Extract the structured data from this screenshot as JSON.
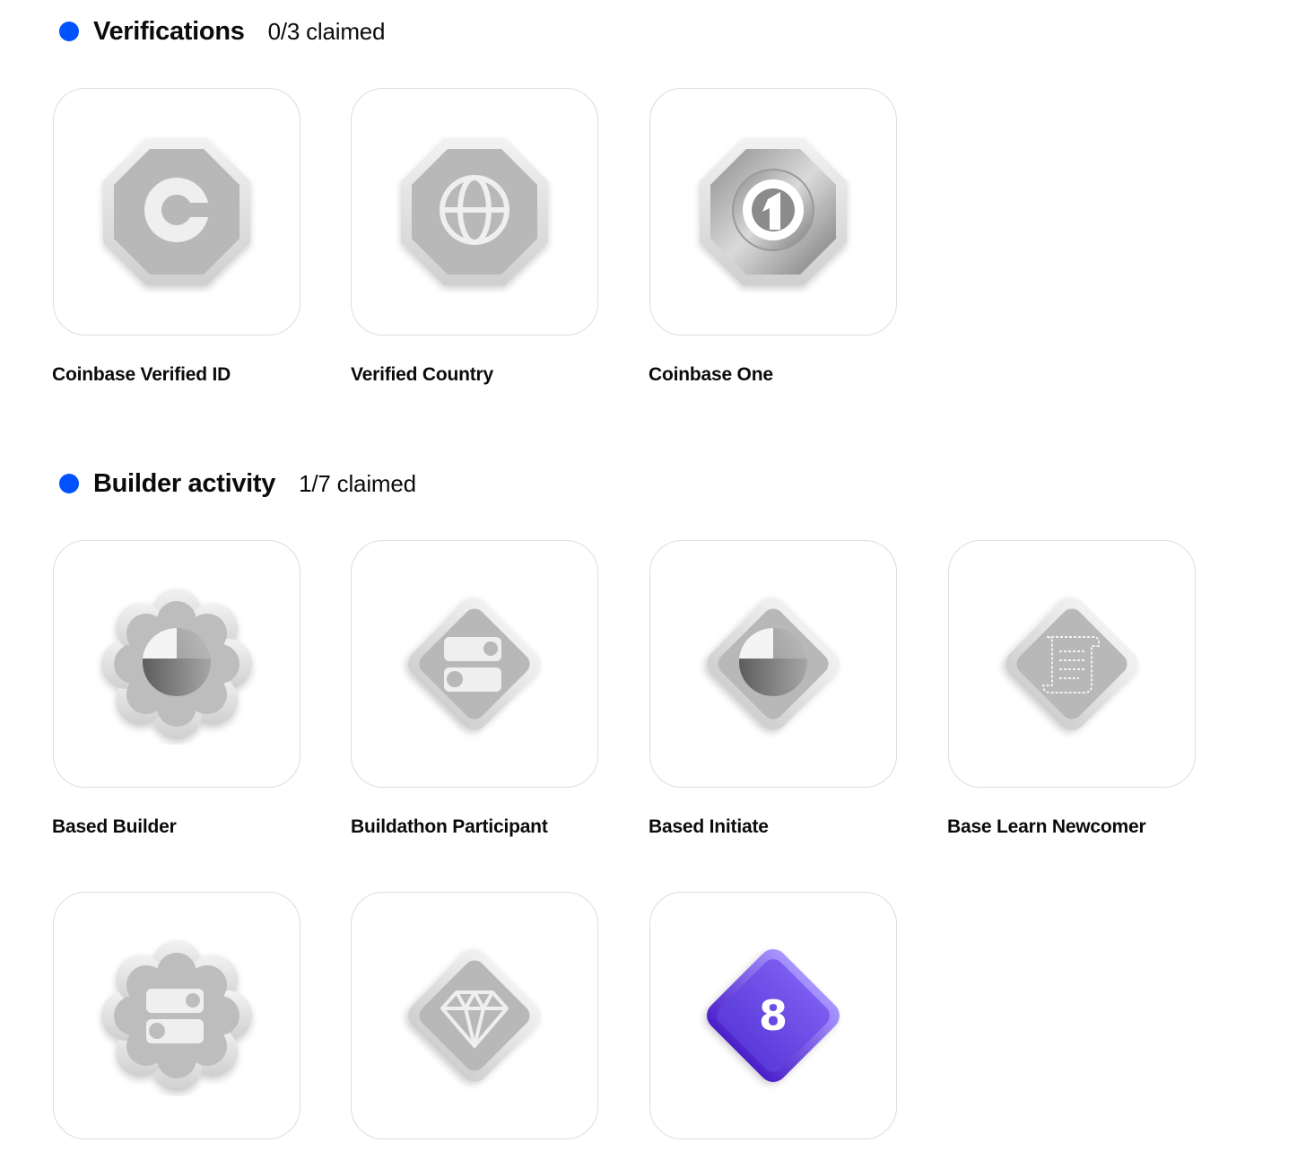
{
  "sections": [
    {
      "title": "Verifications",
      "count": "0/3 claimed",
      "badges": [
        {
          "label": "Coinbase Verified ID",
          "icon": "coinbase-logo-icon",
          "shape": "octagon",
          "claimed": false
        },
        {
          "label": "Verified Country",
          "icon": "globe-icon",
          "shape": "octagon",
          "claimed": false
        },
        {
          "label": "Coinbase One",
          "icon": "coinbase-one-icon",
          "shape": "octagon",
          "claimed": false
        }
      ]
    },
    {
      "title": "Builder activity",
      "count": "1/7 claimed",
      "badges": [
        {
          "label": "Based Builder",
          "icon": "base-logo-icon",
          "shape": "flower",
          "claimed": false
        },
        {
          "label": "Buildathon Participant",
          "icon": "toggle-blocks-icon",
          "shape": "diamond",
          "claimed": false
        },
        {
          "label": "Based Initiate",
          "icon": "base-logo-icon",
          "shape": "diamond",
          "claimed": false
        },
        {
          "label": "Base Learn Newcomer",
          "icon": "scroll-icon",
          "shape": "diamond",
          "claimed": false
        },
        {
          "icon": "toggle-blocks-icon",
          "shape": "flower",
          "claimed": false
        },
        {
          "icon": "gem-icon",
          "shape": "diamond",
          "claimed": false
        },
        {
          "icon": "number-badge-icon",
          "shape": "diamond",
          "claimed": true,
          "number": "8"
        }
      ]
    }
  ],
  "colors": {
    "accent_dot": "#0052ff",
    "claimed_badge": "#6a4ce6",
    "unclaimed_badge": "#b9b9b9"
  }
}
